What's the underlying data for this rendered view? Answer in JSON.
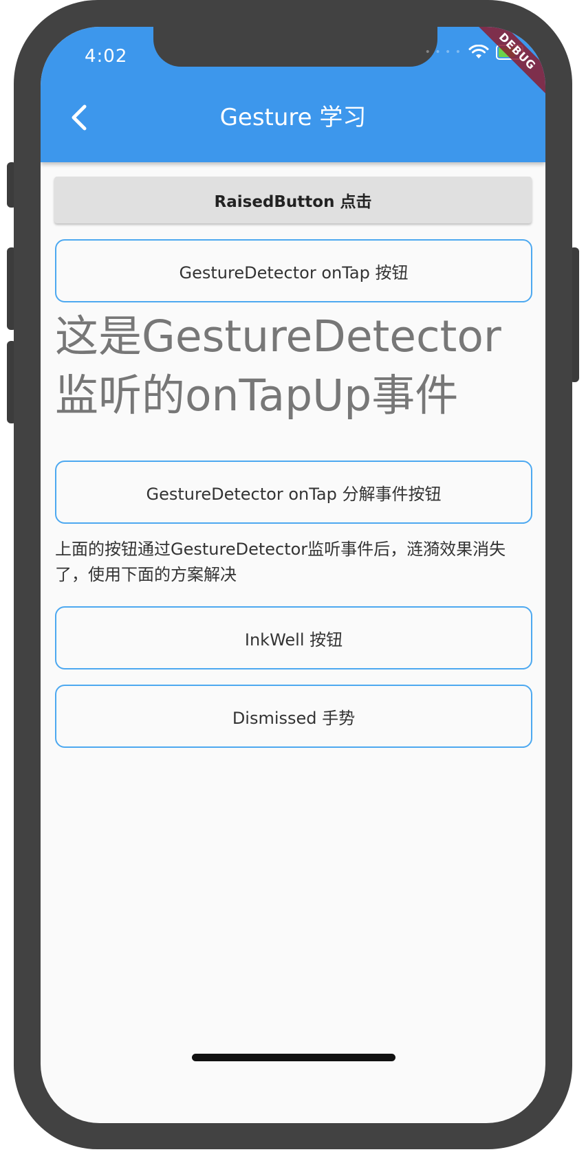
{
  "status_bar": {
    "time": "4:02",
    "debug_banner": "DEBUG"
  },
  "app_bar": {
    "title": "Gesture 学习",
    "back_label": "<"
  },
  "buttons": {
    "raised": "RaisedButton 点击",
    "gesture_on_tap": "GestureDetector onTap 按钮",
    "gesture_on_tap_split": "GestureDetector onTap 分解事件按钮",
    "inkwell": "InkWell 按钮",
    "dismissed": "Dismissed 手势"
  },
  "texts": {
    "tap_up_event": "这是GestureDetector监听的onTapUp事件",
    "ripple_note": "上面的按钮通过GestureDetector监听事件后，涟漪效果消失了，使用下面的方案解决"
  },
  "colors": {
    "app_bar": "#3d97ec",
    "button_border": "#4ca8f0",
    "raised_button": "#e0e0e0",
    "background": "#fafafa",
    "device_frame": "#424242"
  },
  "icons": {
    "back": "chevron-left-icon",
    "wifi": "wifi-icon",
    "battery": "battery-icon"
  }
}
